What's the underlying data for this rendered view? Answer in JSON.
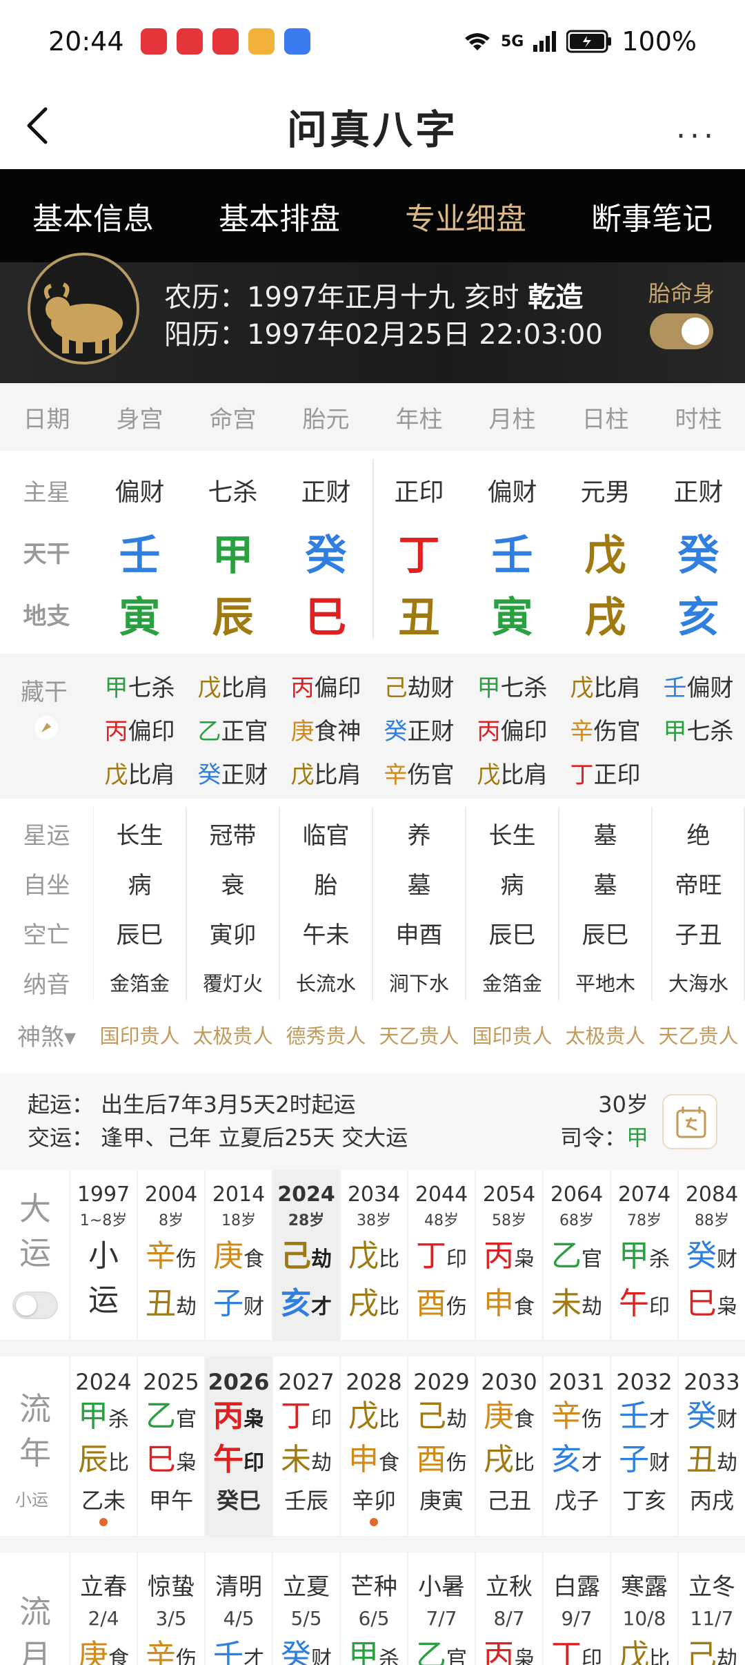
{
  "status": {
    "time": "20:44",
    "network": "5G",
    "battery": "100%"
  },
  "title": "问真八字",
  "more_label": "···",
  "tabs": [
    {
      "label": "基本信息"
    },
    {
      "label": "基本排盘"
    },
    {
      "label": "专业细盘"
    },
    {
      "label": "断事笔记"
    }
  ],
  "banner": {
    "lunar": "农历：1997年正月十九 亥时 ",
    "gender": "乾造",
    "solar": "阳历：1997年02月25日 22:03:00",
    "toggle_label": "胎命身"
  },
  "chart_header": [
    "日期",
    "身宫",
    "命宫",
    "胎元",
    "年柱",
    "月柱",
    "日柱",
    "时柱"
  ],
  "rows": {
    "main_star": {
      "label": "主星",
      "values": [
        "偏财",
        "七杀",
        "正财",
        "正印",
        "偏财",
        "元男",
        "正财"
      ]
    },
    "tiangan": {
      "label": "天干",
      "values": [
        "壬",
        "甲",
        "癸",
        "丁",
        "壬",
        "戊",
        "癸"
      ]
    },
    "dizhi": {
      "label": "地支",
      "values": [
        "寅",
        "辰",
        "巳",
        "丑",
        "寅",
        "戌",
        "亥"
      ]
    }
  },
  "canggan": {
    "label": "藏干",
    "items": [
      [
        "甲",
        "七杀"
      ],
      [
        "戊",
        "比肩"
      ],
      [
        "丙",
        "偏印"
      ],
      [
        "己",
        "劫财"
      ],
      [
        "甲",
        "七杀"
      ],
      [
        "戊",
        "比肩"
      ],
      [
        "壬",
        "偏财"
      ],
      [
        "丙",
        "偏印"
      ],
      [
        "乙",
        "正官"
      ],
      [
        "庚",
        "食神"
      ],
      [
        "癸",
        "正财"
      ],
      [
        "丙",
        "偏印"
      ],
      [
        "辛",
        "伤官"
      ],
      [
        "甲",
        "七杀"
      ],
      [
        "戊",
        "比肩"
      ],
      [
        "癸",
        "正财"
      ],
      [
        "戊",
        "比肩"
      ],
      [
        "辛",
        "伤官"
      ],
      [
        "戊",
        "比肩"
      ],
      [
        "丁",
        "正印"
      ],
      [
        "",
        ""
      ]
    ]
  },
  "xingyun": {
    "label": "星运",
    "values": [
      "长生",
      "冠带",
      "临官",
      "养",
      "长生",
      "墓",
      "绝"
    ]
  },
  "zizuo": {
    "label": "自坐",
    "values": [
      "病",
      "衰",
      "胎",
      "墓",
      "病",
      "墓",
      "帝旺"
    ]
  },
  "kongwang": {
    "label": "空亡",
    "values": [
      "辰巳",
      "寅卯",
      "午未",
      "申酉",
      "辰巳",
      "辰巳",
      "子丑"
    ]
  },
  "nayin": {
    "label": "纳音",
    "values": [
      "金箔金",
      "覆灯火",
      "长流水",
      "涧下水",
      "金箔金",
      "平地木",
      "大海水"
    ]
  },
  "shensha": {
    "label": "神煞▾",
    "values": [
      "国印贵人",
      "太极贵人",
      "德秀贵人",
      "天乙贵人",
      "国印贵人",
      "太极贵人",
      "天乙贵人"
    ]
  },
  "qiyun": {
    "line1": "起运：  出生后7年3月5天2时起运",
    "line2": "交运：  逢甲、己年 立夏后25天 交大运",
    "age": "30岁",
    "siling_label": "司令：",
    "siling_value": "甲"
  },
  "dayun": {
    "label1": "大",
    "label2": "运",
    "cols": [
      {
        "year": "1997",
        "age": "1~8岁",
        "top": "小",
        "top_ss": "",
        "bot": "运",
        "bot_ss": ""
      },
      {
        "year": "2004",
        "age": "8岁",
        "top": "辛",
        "top_ss": "伤",
        "bot": "丑",
        "bot_ss": "劫"
      },
      {
        "year": "2014",
        "age": "18岁",
        "top": "庚",
        "top_ss": "食",
        "bot": "子",
        "bot_ss": "财"
      },
      {
        "year": "2024",
        "age": "28岁",
        "top": "己",
        "top_ss": "劫",
        "bot": "亥",
        "bot_ss": "才"
      },
      {
        "year": "2034",
        "age": "38岁",
        "top": "戊",
        "top_ss": "比",
        "bot": "戌",
        "bot_ss": "比"
      },
      {
        "year": "2044",
        "age": "48岁",
        "top": "丁",
        "top_ss": "印",
        "bot": "酉",
        "bot_ss": "伤"
      },
      {
        "year": "2054",
        "age": "58岁",
        "top": "丙",
        "top_ss": "枭",
        "bot": "申",
        "bot_ss": "食"
      },
      {
        "year": "2064",
        "age": "68岁",
        "top": "乙",
        "top_ss": "官",
        "bot": "未",
        "bot_ss": "劫"
      },
      {
        "year": "2074",
        "age": "78岁",
        "top": "甲",
        "top_ss": "杀",
        "bot": "午",
        "bot_ss": "印"
      },
      {
        "year": "2084",
        "age": "88岁",
        "top": "癸",
        "top_ss": "财",
        "bot": "巳",
        "bot_ss": "枭"
      }
    ]
  },
  "liunian": {
    "label1": "流",
    "label2": "年",
    "label3": "小运",
    "cols": [
      {
        "year": "2024",
        "top": "甲",
        "top_ss": "杀",
        "bot": "辰",
        "bot_ss": "比",
        "xy": "乙未"
      },
      {
        "year": "2025",
        "top": "乙",
        "top_ss": "官",
        "bot": "巳",
        "bot_ss": "枭",
        "xy": "甲午"
      },
      {
        "year": "2026",
        "top": "丙",
        "top_ss": "枭",
        "bot": "午",
        "bot_ss": "印",
        "xy": "癸巳"
      },
      {
        "year": "2027",
        "top": "丁",
        "top_ss": "印",
        "bot": "未",
        "bot_ss": "劫",
        "xy": "壬辰"
      },
      {
        "year": "2028",
        "top": "戊",
        "top_ss": "比",
        "bot": "申",
        "bot_ss": "食",
        "xy": "辛卯"
      },
      {
        "year": "2029",
        "top": "己",
        "top_ss": "劫",
        "bot": "酉",
        "bot_ss": "伤",
        "xy": "庚寅"
      },
      {
        "year": "2030",
        "top": "庚",
        "top_ss": "食",
        "bot": "戌",
        "bot_ss": "比",
        "xy": "己丑"
      },
      {
        "year": "2031",
        "top": "辛",
        "top_ss": "伤",
        "bot": "亥",
        "bot_ss": "才",
        "xy": "戊子"
      },
      {
        "year": "2032",
        "top": "壬",
        "top_ss": "才",
        "bot": "子",
        "bot_ss": "财",
        "xy": "丁亥"
      },
      {
        "year": "2033",
        "top": "癸",
        "top_ss": "财",
        "bot": "丑",
        "bot_ss": "劫",
        "xy": "丙戌"
      }
    ]
  },
  "liuyue": {
    "label1": "流",
    "label2": "月",
    "cols": [
      {
        "term": "立春",
        "date": "2/4",
        "top": "庚",
        "top_ss": "食"
      },
      {
        "term": "惊蛰",
        "date": "3/5",
        "top": "辛",
        "top_ss": "伤"
      },
      {
        "term": "清明",
        "date": "4/5",
        "top": "壬",
        "top_ss": "才"
      },
      {
        "term": "立夏",
        "date": "5/5",
        "top": "癸",
        "top_ss": "财"
      },
      {
        "term": "芒种",
        "date": "6/5",
        "top": "甲",
        "top_ss": "杀"
      },
      {
        "term": "小暑",
        "date": "7/7",
        "top": "乙",
        "top_ss": "官"
      },
      {
        "term": "立秋",
        "date": "8/7",
        "top": "丙",
        "top_ss": "枭"
      },
      {
        "term": "白露",
        "date": "9/7",
        "top": "丁",
        "top_ss": "印"
      },
      {
        "term": "寒露",
        "date": "10/8",
        "top": "戊",
        "top_ss": "比"
      },
      {
        "term": "立冬",
        "date": "11/7",
        "top": "己",
        "top_ss": "劫"
      }
    ]
  },
  "element_colors": {
    "water": "#2f7fe0",
    "wood": "#2aa040",
    "fire": "#e02020",
    "earth": "#a07a10",
    "metal": "#d08a1a"
  }
}
